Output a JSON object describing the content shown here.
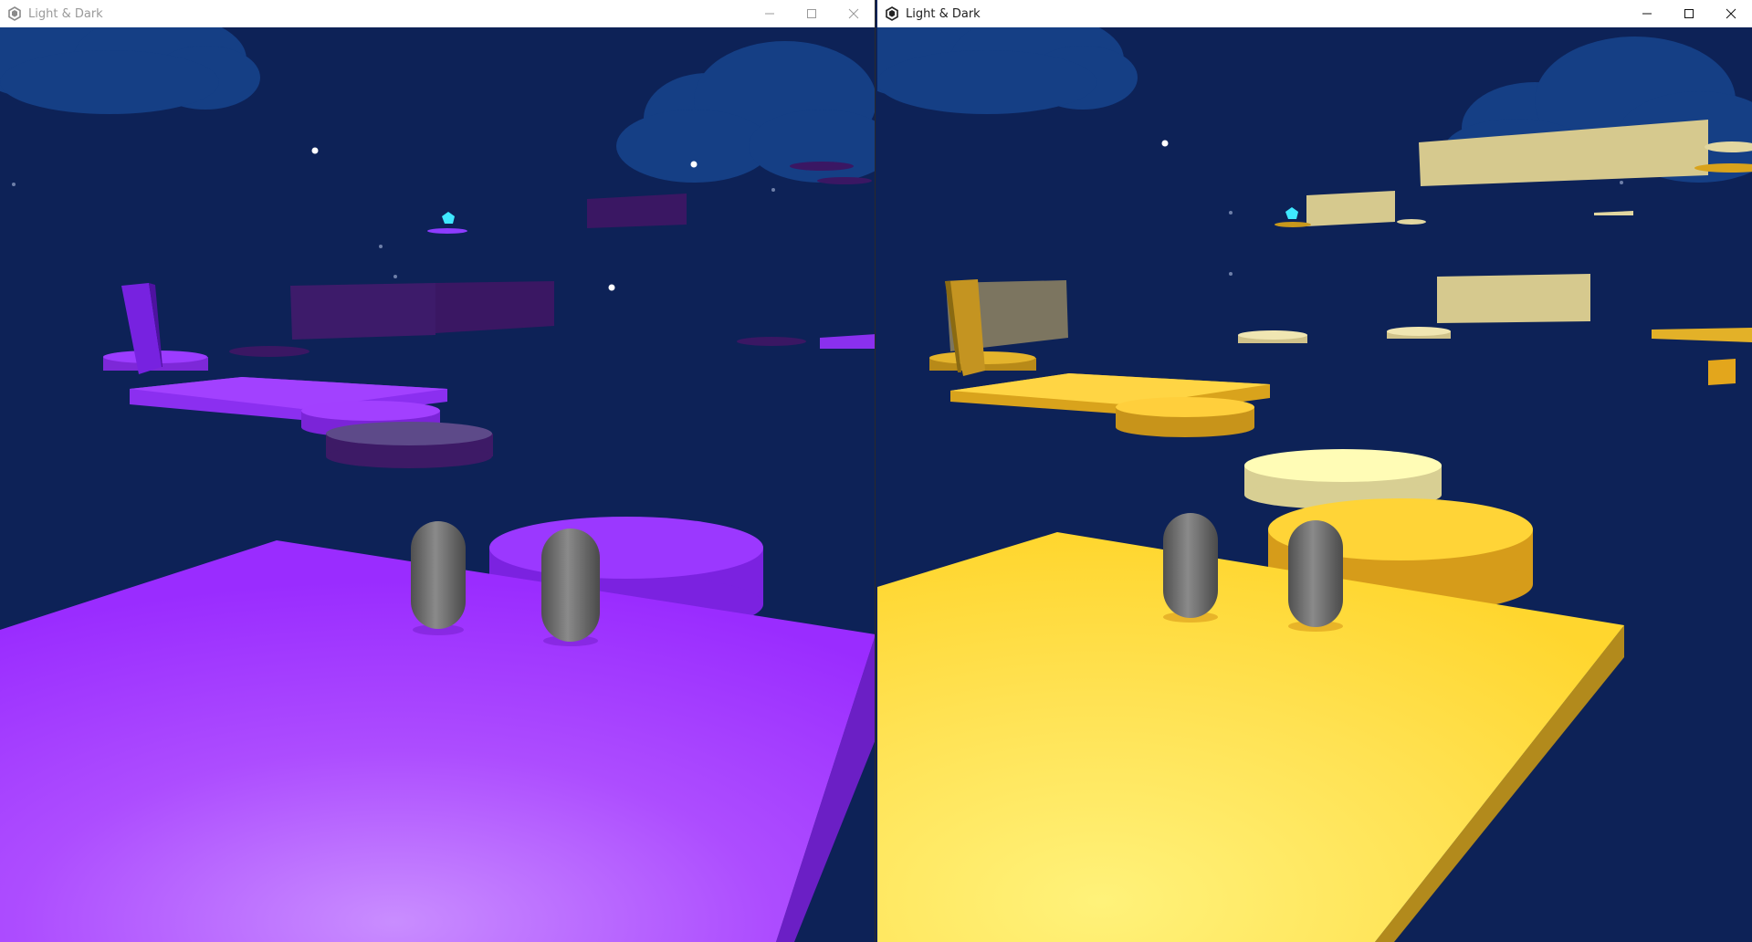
{
  "windows": [
    {
      "title": "Light & Dark",
      "icon": "unity-logo-icon",
      "controls": [
        "minimize-icon",
        "maximize-icon",
        "close-icon"
      ],
      "state": "inactive",
      "theme": "dark-purple"
    },
    {
      "title": "Light & Dark",
      "icon": "unity-logo-icon",
      "controls": [
        "minimize-icon",
        "maximize-icon",
        "close-icon"
      ],
      "state": "active",
      "theme": "light-yellow"
    }
  ],
  "colors": {
    "sky": "#0d2257",
    "cloud": "#153f85",
    "purple_main": "#a035ff",
    "purple_dark": "#3d1a66",
    "yellow_main": "#ffd93a",
    "yellow_dark": "#c8981c",
    "pale_platform": "#d8cf93",
    "player": "#6f6f6f",
    "crystal": "#3fe8ff"
  }
}
